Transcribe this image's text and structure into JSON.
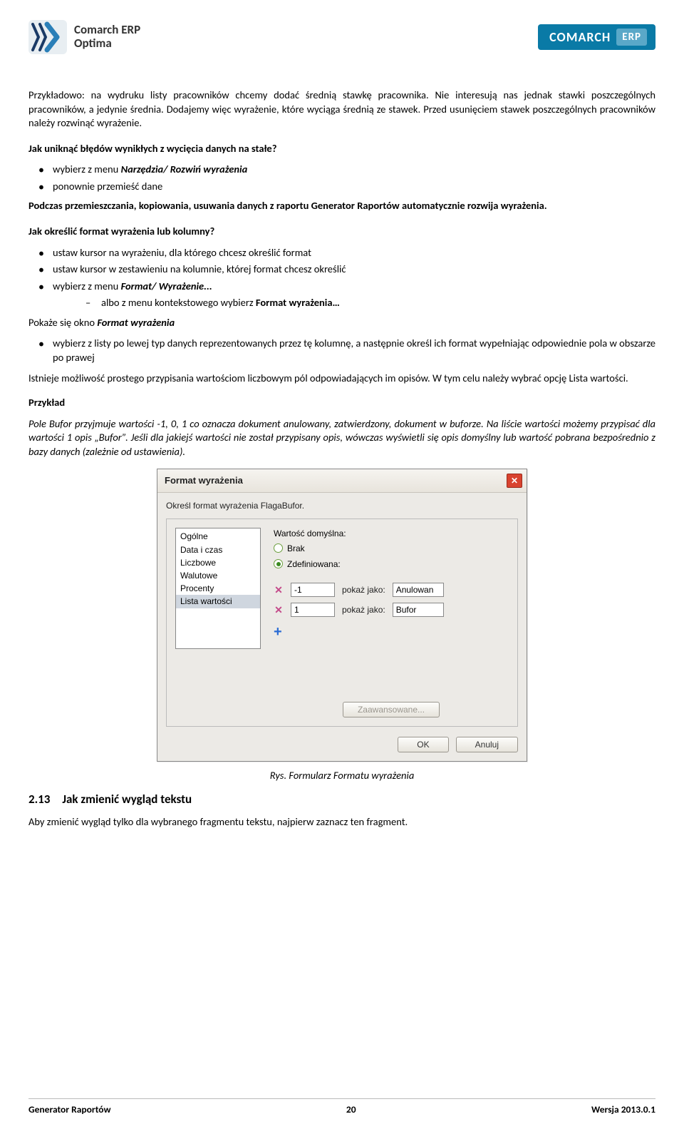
{
  "header": {
    "product_line1": "Comarch ERP",
    "product_line2": "Optima",
    "brand": "COMARCH",
    "brand_tag": "ERP"
  },
  "intro_p1": "Przykładowo: na wydruku listy pracowników chcemy dodać średnią stawkę pracownika. Nie interesują nas jednak stawki poszczególnych pracowników, a jedynie średnia. Dodajemy więc wyrażenie, które wyciąga średnią ze stawek. Przed usunięciem stawek poszczególnych pracowników należy rozwinąć wyrażenie.",
  "q1": "Jak uniknąć błędów wynikłych z wycięcia danych na stałe?",
  "q1_b1_pre": "wybierz z menu ",
  "q1_b1_em": "Narzędzia/ Rozwiń wyrażenia",
  "q1_b2": "ponownie przemieść dane",
  "p_after_q1": "Podczas przemieszczania, kopiowania, usuwania danych z raportu Generator Raportów automatycznie rozwija wyrażenia.",
  "q2": "Jak określić format wyrażenia lub kolumny?",
  "q2_b1": "ustaw kursor na wyrażeniu, dla którego chcesz określić format",
  "q2_b2": "ustaw kursor w zestawieniu na kolumnie, której format chcesz określić",
  "q2_b3_pre": "wybierz z menu ",
  "q2_b3_em": "Format/ Wyrażenie...",
  "q2_sub_pre": "albo z menu kontekstowego wybierz ",
  "q2_sub_bold": "Format wyrażenia…",
  "after_sub_pre": "Pokaże się okno ",
  "after_sub_em": "Format wyrażenia",
  "q2_b4": "wybierz z listy po lewej typ danych reprezentowanych przez tę kolumnę, a następnie określ ich format wypełniając odpowiednie pola w obszarze po prawej",
  "p_after_q2": "Istnieje możliwość prostego przypisania wartościom liczbowym pól odpowiadających im opisów. W tym celu należy wybrać opcję Lista wartości.",
  "example_h": "Przykład",
  "example_p": "Pole Bufor przyjmuje wartości -1, 0, 1 co oznacza dokument anulowany, zatwierdzony, dokument w buforze. Na liście wartości możemy przypisać dla wartości 1 opis „Bufor”. Jeśli dla jakiejś wartości nie został przypisany opis, wówczas wyświetli się opis domyślny lub wartość pobrana bezpośrednio z bazy danych (zależnie od ustawienia).",
  "dialog": {
    "title": "Format wyrażenia",
    "desc": "Określ format wyrażenia FlagaBufor.",
    "types": [
      "Ogólne",
      "Data i czas",
      "Liczbowe",
      "Walutowe",
      "Procenty",
      "Lista wartości"
    ],
    "selected_type_index": 5,
    "default_label": "Wartość domyślna:",
    "radio_none": "Brak",
    "radio_defined": "Zdefiniowana:",
    "radio_checked": "defined",
    "rows": [
      {
        "value": "-1",
        "show_as_label": "pokaż jako:",
        "display": "Anulowan"
      },
      {
        "value": "1",
        "show_as_label": "pokaż jako:",
        "display": "Bufor"
      }
    ],
    "advanced": "Zaawansowane...",
    "ok": "OK",
    "cancel": "Anuluj"
  },
  "fig_caption": "Rys. Formularz Formatu wyrażenia",
  "h2": "2.13 Jak zmienić wygląd tekstu",
  "p_after_h2": "Aby zmienić wygląd tylko dla wybranego fragmentu tekstu, najpierw zaznacz ten fragment.",
  "footer": {
    "left": "Generator Raportów",
    "center": "20",
    "right": "Wersja 2013.0.1"
  }
}
